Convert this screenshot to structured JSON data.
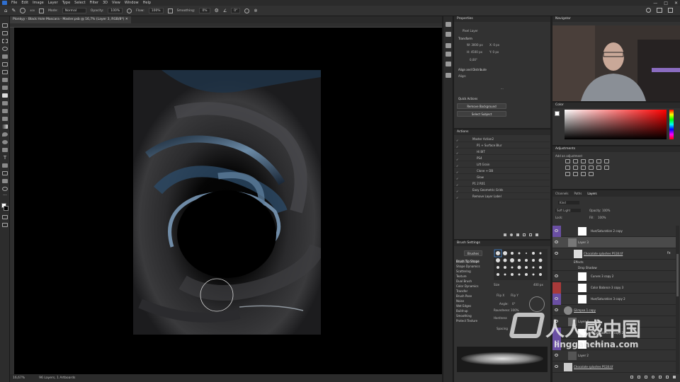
{
  "menu": [
    "File",
    "Edit",
    "Image",
    "Layer",
    "Type",
    "Select",
    "Filter",
    "3D",
    "View",
    "Window",
    "Help"
  ],
  "window_controls": [
    "—",
    "□",
    "✕"
  ],
  "options": {
    "mode_label": "Mode:",
    "mode_value": "Normal",
    "opacity_label": "Opacity:",
    "opacity_value": "100%",
    "flow_label": "Flow:",
    "flow_value": "100%",
    "smoothing_label": "Smoothing:",
    "smoothing_value": "0%",
    "angle_value": "0°",
    "brush_size": "400"
  },
  "document_tab": "Plonkyy - Black Hole Mascara - Master.psb @ 16,7% (Layer 3, RGB/8*) ✕",
  "status": {
    "zoom": "16,67%",
    "info": "96 Layers, 1 Artboards"
  },
  "properties": {
    "title": "Properties",
    "pixel_layer": "Pixel Layer",
    "transform_title": "Transform",
    "w": "W: 3000 px",
    "h": "H: 4500 px",
    "x": "X: 0 px",
    "y": "Y: 0 px",
    "angle": "0,00°",
    "align_title": "Align and Distribute",
    "align_label": "Align:",
    "quick_title": "Quick Actions",
    "remove_bg": "Remove Background",
    "select_subject": "Select Subject"
  },
  "actions": {
    "title": "Actions",
    "items": [
      "Master Action2",
      "P1 + Surface Blur",
      "Hi BIT",
      "PS4",
      "Lift Grain",
      "Clone + DB",
      "Glow",
      "P1 2 R01",
      "Easy Geometric Grids",
      "Remove Layer Label"
    ]
  },
  "brush_settings": {
    "title": "Brush Settings",
    "brushes_btn": "Brushes",
    "items": [
      "Brush Tip Shape",
      "Shape Dynamics",
      "Scattering",
      "Texture",
      "Dual Brush",
      "Color Dynamics",
      "Transfer",
      "Brush Pose",
      "Noise",
      "Wet Edges",
      "Build-up",
      "Smoothing",
      "Protect Texture"
    ],
    "size_label": "Size",
    "size_value": "400 px",
    "flip_x": "Flip X",
    "flip_y": "Flip Y",
    "angle_label": "Angle:",
    "angle_value": "0°",
    "roundness_label": "Roundness:",
    "roundness_value": "100%",
    "hardness_label": "Hardness",
    "spacing_label": "Spacing"
  },
  "navigator": {
    "title": "Navigator"
  },
  "color": {
    "title": "Color"
  },
  "adjustments": {
    "title": "Adjustments",
    "add_label": "Add an adjustment"
  },
  "layers": {
    "tabs": [
      "Channels",
      "Paths",
      "Layers"
    ],
    "kind": "Kind",
    "blend": "Soft Light",
    "opacity_label": "Opacity:",
    "opacity_value": "100%",
    "lock_label": "Lock:",
    "fill_label": "Fill:",
    "fill_value": "100%",
    "rows": [
      "Hue/Saturation 2 copy",
      "Layer 3",
      "Chocolate splashes PS18.tif",
      "Effects",
      "Drop Shadow",
      "Curves 3 copy 2",
      "Color Balance 3 copy 3",
      "Hue/Saturation 3 copy 2",
      "Glimpse 1 copy",
      "Layer 4",
      "Color Balance 3 copy 2",
      "Levels 1",
      "Layer 2",
      "Chocolate splashes PS18.tif"
    ]
  },
  "watermark": {
    "cn": "人人感中国",
    "en": "lingganchina.com"
  },
  "colors": {
    "accent": "#2f6fd0",
    "layer_purple": "#6a4fa3",
    "layer_red": "#a83a3a"
  }
}
